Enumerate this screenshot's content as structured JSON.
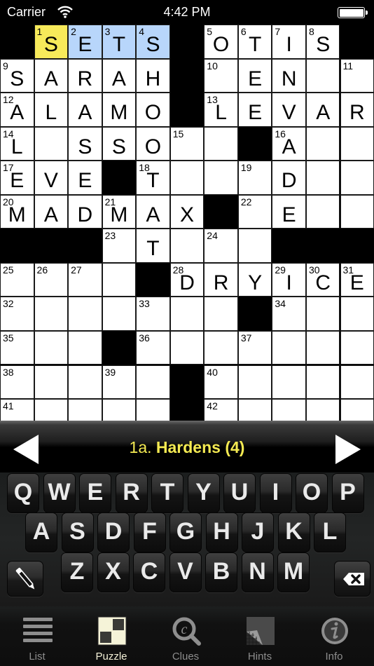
{
  "status_bar": {
    "carrier": "Carrier",
    "time": "4:42 PM",
    "battery_level": 1.0
  },
  "colors": {
    "active_cell": "#f7ea5a",
    "active_word": "#b8d6fb",
    "clue_text": "#f4ea52",
    "tab_active": "#f2efd6",
    "tab_inactive": "#8d8d8d"
  },
  "puzzle": {
    "columns": 11,
    "visible_rows": 12,
    "active_cell": [
      0,
      1
    ],
    "active_word_cells": [
      [
        0,
        1
      ],
      [
        0,
        2
      ],
      [
        0,
        3
      ],
      [
        0,
        4
      ]
    ],
    "rows": [
      [
        {
          "b": 1
        },
        {
          "n": "1",
          "l": "S"
        },
        {
          "n": "2",
          "l": "E"
        },
        {
          "n": "3",
          "l": "T"
        },
        {
          "n": "4",
          "l": "S"
        },
        {
          "b": 1
        },
        {
          "n": "5",
          "l": "O"
        },
        {
          "n": "6",
          "l": "T"
        },
        {
          "n": "7",
          "l": "I"
        },
        {
          "n": "8",
          "l": "S"
        },
        {
          "b": 1
        }
      ],
      [
        {
          "n": "9",
          "l": "S"
        },
        {
          "l": "A"
        },
        {
          "l": "R"
        },
        {
          "l": "A"
        },
        {
          "l": "H"
        },
        {
          "b": 1
        },
        {
          "n": "10"
        },
        {
          "l": "E"
        },
        {
          "l": "N"
        },
        {},
        {
          "n": "11"
        }
      ],
      [
        {
          "n": "12",
          "l": "A"
        },
        {
          "l": "L"
        },
        {
          "l": "A"
        },
        {
          "l": "M"
        },
        {
          "l": "O"
        },
        {
          "b": 1
        },
        {
          "n": "13",
          "l": "L"
        },
        {
          "l": "E"
        },
        {
          "l": "V"
        },
        {
          "l": "A"
        },
        {
          "l": "R"
        }
      ],
      [
        {
          "n": "14",
          "l": "L"
        },
        {},
        {
          "l": "S"
        },
        {
          "l": "S"
        },
        {
          "l": "O"
        },
        {
          "n": "15"
        },
        {},
        {
          "b": 1
        },
        {
          "n": "16",
          "l": "A"
        },
        {},
        {}
      ],
      [
        {
          "n": "17",
          "l": "E"
        },
        {
          "l": "V"
        },
        {
          "l": "E"
        },
        {
          "b": 1
        },
        {
          "n": "18",
          "l": "T"
        },
        {},
        {},
        {
          "n": "19"
        },
        {
          "l": "D"
        },
        {},
        {}
      ],
      [
        {
          "n": "20",
          "l": "M"
        },
        {
          "l": "A"
        },
        {
          "l": "D"
        },
        {
          "n": "21",
          "l": "M"
        },
        {
          "l": "A"
        },
        {
          "l": "X"
        },
        {
          "b": 1
        },
        {
          "n": "22"
        },
        {
          "l": "E"
        },
        {},
        {}
      ],
      [
        {
          "b": 1
        },
        {
          "b": 1
        },
        {
          "b": 1
        },
        {
          "n": "23"
        },
        {
          "l": "T"
        },
        {},
        {
          "n": "24"
        },
        {},
        {
          "b": 1
        },
        {
          "b": 1
        },
        {
          "b": 1
        }
      ],
      [
        {
          "n": "25"
        },
        {
          "n": "26"
        },
        {
          "n": "27"
        },
        {},
        {
          "b": 1
        },
        {
          "n": "28",
          "l": "D"
        },
        {
          "l": "R"
        },
        {
          "l": "Y"
        },
        {
          "n": "29",
          "l": "I"
        },
        {
          "n": "30",
          "l": "C"
        },
        {
          "n": "31",
          "l": "E"
        }
      ],
      [
        {
          "n": "32"
        },
        {},
        {},
        {},
        {
          "n": "33"
        },
        {},
        {},
        {
          "b": 1
        },
        {
          "n": "34"
        },
        {},
        {}
      ],
      [
        {
          "n": "35"
        },
        {},
        {},
        {
          "b": 1
        },
        {
          "n": "36"
        },
        {},
        {},
        {
          "n": "37"
        },
        {},
        {},
        {}
      ],
      [
        {
          "n": "38"
        },
        {},
        {},
        {
          "n": "39"
        },
        {},
        {
          "b": 1
        },
        {
          "n": "40"
        },
        {},
        {},
        {},
        {}
      ],
      [
        {
          "n": "41"
        },
        {},
        {},
        {},
        {},
        {
          "b": 1
        },
        {
          "n": "42"
        },
        {},
        {},
        {},
        {}
      ]
    ]
  },
  "clue_bar": {
    "prev_icon": "left-arrow-icon",
    "next_icon": "right-arrow-icon",
    "clue_number": "1a.",
    "clue_text": "Hardens (4)"
  },
  "keyboard": {
    "row1": [
      "Q",
      "W",
      "E",
      "R",
      "T",
      "Y",
      "U",
      "I",
      "O",
      "P"
    ],
    "row2": [
      "A",
      "S",
      "D",
      "F",
      "G",
      "H",
      "J",
      "K",
      "L"
    ],
    "row3": [
      "Z",
      "X",
      "C",
      "V",
      "B",
      "N",
      "M"
    ],
    "pencil_icon": "pencil-icon",
    "backspace_icon": "backspace-icon"
  },
  "tab_bar": {
    "active": "Puzzle",
    "tabs": [
      {
        "label": "List",
        "icon": "list-icon"
      },
      {
        "label": "Puzzle",
        "icon": "puzzle-grid-icon"
      },
      {
        "label": "Clues",
        "icon": "clues-search-icon"
      },
      {
        "label": "Hints",
        "icon": "hints-page-curl-icon"
      },
      {
        "label": "Info",
        "icon": "info-icon"
      }
    ]
  }
}
